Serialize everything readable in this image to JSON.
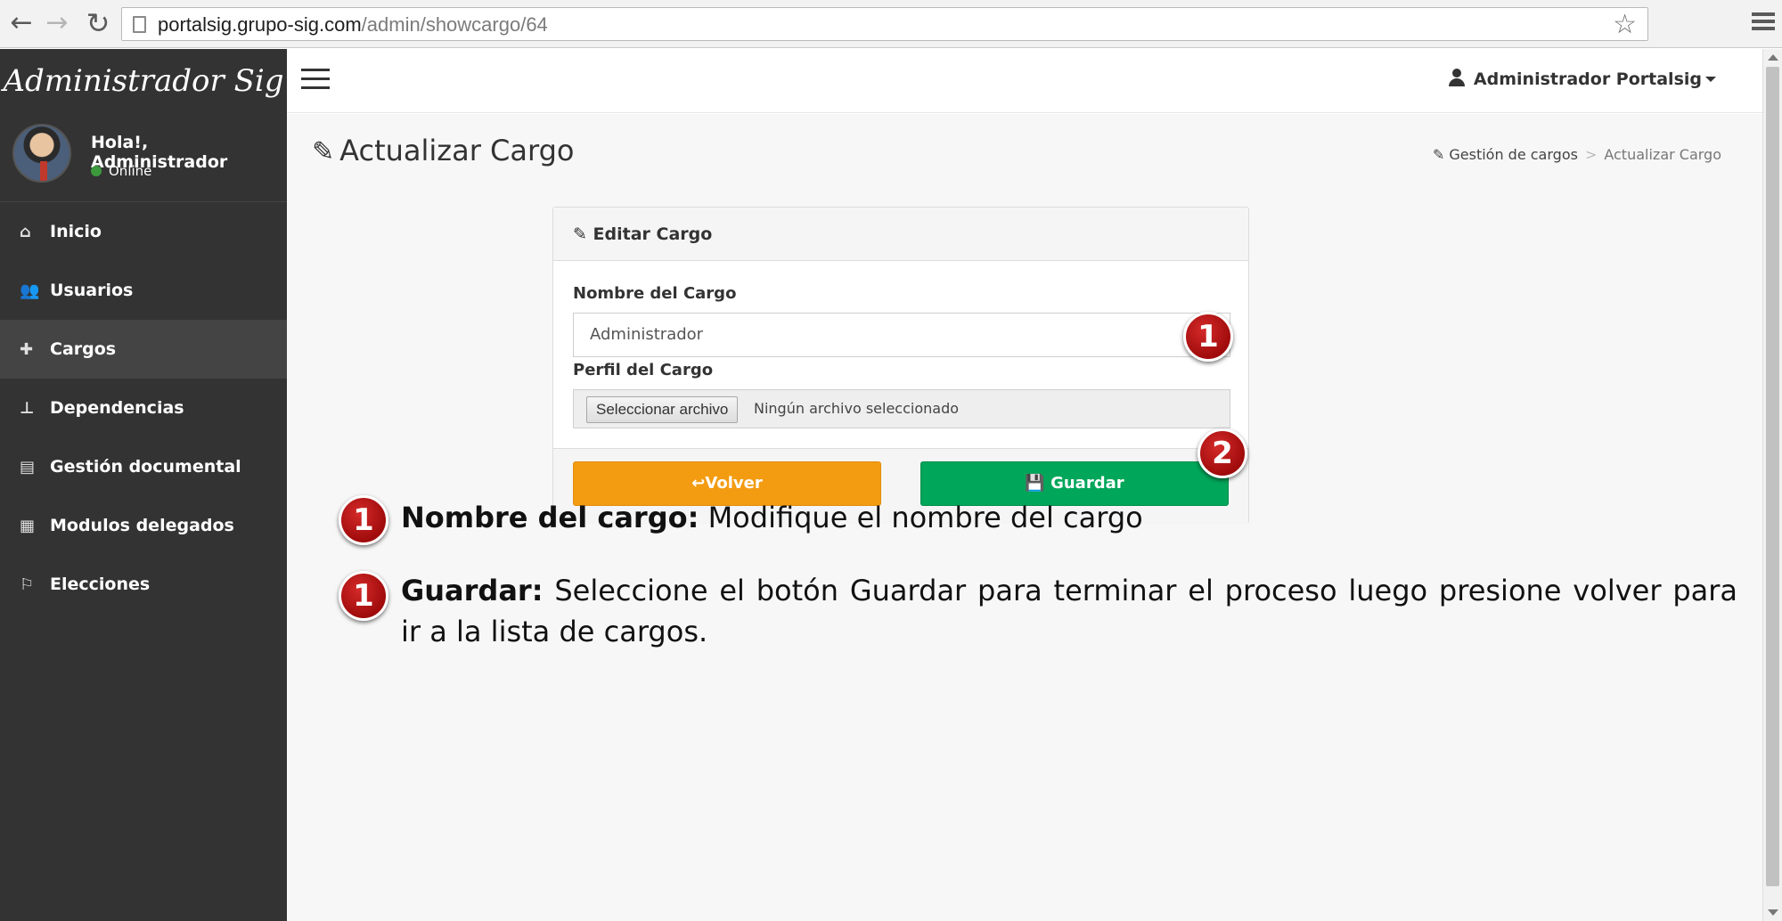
{
  "browser": {
    "url_host": "portalsig.grupo-sig.com",
    "url_path": "/admin/showcargo/64"
  },
  "sidebar": {
    "brand": "Administrador Sig",
    "greeting": "Hola!, Administrador",
    "status": "Online",
    "items": [
      {
        "label": "Inicio",
        "icon": "home-icon"
      },
      {
        "label": "Usuarios",
        "icon": "users-icon"
      },
      {
        "label": "Cargos",
        "icon": "puzzle-icon",
        "active": true
      },
      {
        "label": "Dependencias",
        "icon": "sitemap-icon"
      },
      {
        "label": "Gestión documental",
        "icon": "book-icon"
      },
      {
        "label": "Modulos delegados",
        "icon": "grid-icon"
      },
      {
        "label": "Elecciones",
        "icon": "flag-icon"
      }
    ]
  },
  "header": {
    "user_name": "Administrador Portalsig"
  },
  "page": {
    "title": "Actualizar Cargo",
    "breadcrumb": [
      "Gestión de cargos",
      "Actualizar Cargo"
    ]
  },
  "form": {
    "panel_title": "Editar Cargo",
    "name_label": "Nombre del Cargo",
    "name_value": "Administrador",
    "profile_label": "Perfil del Cargo",
    "file_button": "Seleccionar archivo",
    "file_status": "Ningún archivo seleccionado",
    "back_label": "Volver",
    "save_label": "Guardar"
  },
  "callouts": {
    "field_marker": "1",
    "save_marker": "2",
    "note1_marker": "1",
    "note2_marker": "1"
  },
  "notes": [
    {
      "title": "Nombre del cargo:",
      "text": " Modifique el nombre del cargo"
    },
    {
      "title": "Guardar:",
      "text": " Seleccione el botón Guardar para terminar el proceso luego presione volver para ir a la lista de cargos."
    }
  ],
  "colors": {
    "sidebar_bg": "#333333",
    "warning": "#f39c12",
    "success": "#00a65a",
    "callout_red": "#b01010"
  }
}
